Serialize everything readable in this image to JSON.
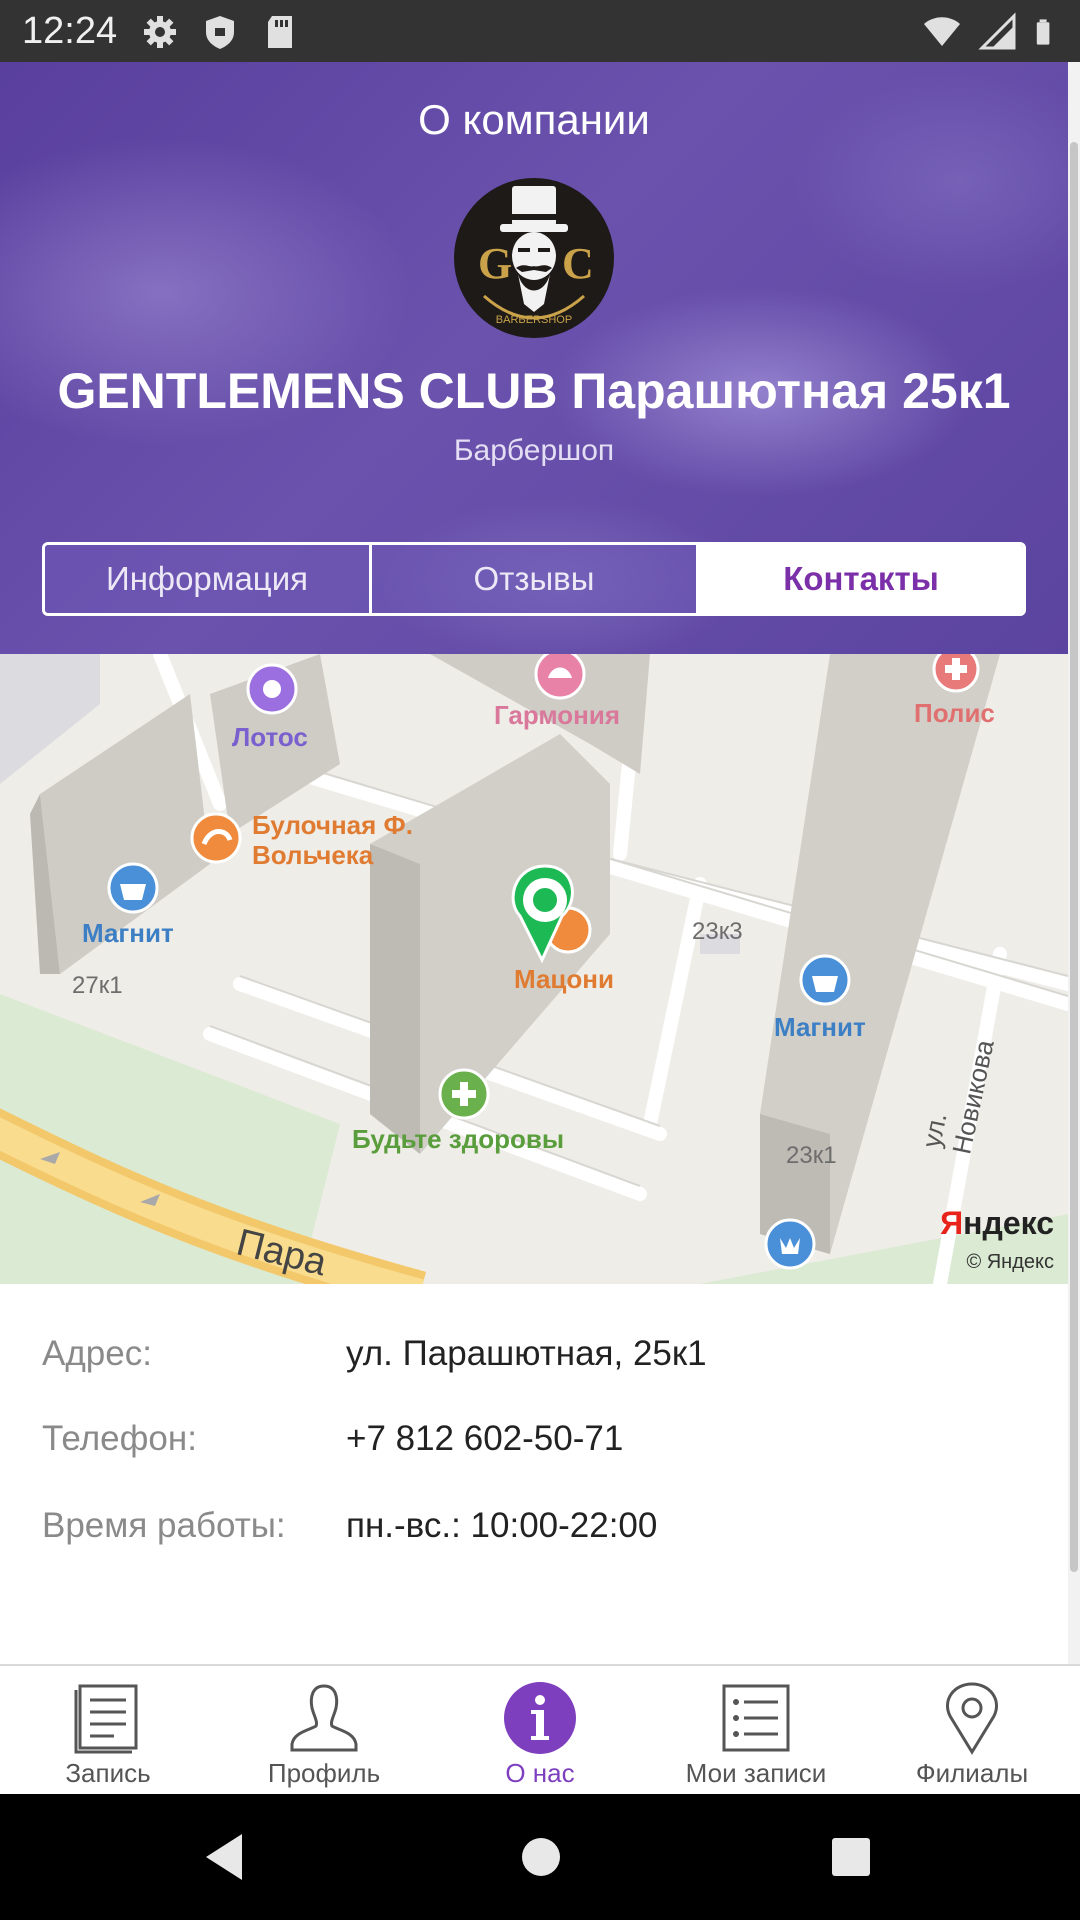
{
  "status_bar": {
    "time": "12:24",
    "left_icons": [
      "gear-icon",
      "shield-icon",
      "sd-card-icon"
    ],
    "right_icons": [
      "wifi-icon",
      "cell-signal-icon",
      "battery-icon"
    ]
  },
  "header": {
    "title": "О компании",
    "logo_letters": [
      "G",
      "C"
    ],
    "logo_caption": "BARBERSHOP",
    "company_name": "GENTLEMENS CLUB Парашютная 25к1",
    "company_type": "Барбершоп",
    "tabs": [
      {
        "label": "Информация",
        "active": false
      },
      {
        "label": "Отзывы",
        "active": false
      },
      {
        "label": "Контакты",
        "active": true
      }
    ]
  },
  "map": {
    "pois": [
      {
        "name": "Лотос",
        "icon": "flower-icon",
        "color": "#9b6fe0"
      },
      {
        "name": "Гармония",
        "icon": "lotus-icon",
        "color": "#e882a6"
      },
      {
        "name": "Полис",
        "icon": "cross-icon",
        "color": "#e87a7a"
      },
      {
        "name": "Булочная Ф. Вольчека",
        "icon": "bakery-icon",
        "color": "#f08a3c"
      },
      {
        "name": "Магнит",
        "icon": "basket-icon",
        "color": "#4a90d9"
      },
      {
        "name": "Мацони",
        "icon": "cafe-icon",
        "color": "#f08a3c"
      },
      {
        "name": "Магнит",
        "icon": "basket-icon",
        "color": "#4a90d9"
      },
      {
        "name": "Будьте здоровы",
        "icon": "pharmacy-icon",
        "color": "#6ab04c"
      }
    ],
    "house_numbers": [
      "27к1",
      "23к3",
      "23к1"
    ],
    "street_labels": [
      "ул. Новикова",
      "Пара"
    ],
    "brand": "Яндекс",
    "brand_first_letter": "Я",
    "brand_rest": "ндекс",
    "copyright": "© Яндекс",
    "marker_color": "#1db954"
  },
  "contacts": {
    "address_label": "Адрес:",
    "address_value": "ул. Парашютная, 25к1",
    "phone_label": "Телефон:",
    "phone_value": "+7 812 602-50-71",
    "hours_label": "Время работы:",
    "hours_value": "пн.-вс.: 10:00-22:00"
  },
  "bottom_nav": [
    {
      "label": "Запись",
      "icon": "document-icon",
      "active": false
    },
    {
      "label": "Профиль",
      "icon": "person-icon",
      "active": false
    },
    {
      "label": "О нас",
      "icon": "info-icon",
      "active": true
    },
    {
      "label": "Мои записи",
      "icon": "list-icon",
      "active": false
    },
    {
      "label": "Филиалы",
      "icon": "location-pin-icon",
      "active": false
    }
  ],
  "colors": {
    "accent": "#7e3fbf",
    "header_purple": "#5a3f9e",
    "active_tab_text": "#7b2fa8"
  }
}
